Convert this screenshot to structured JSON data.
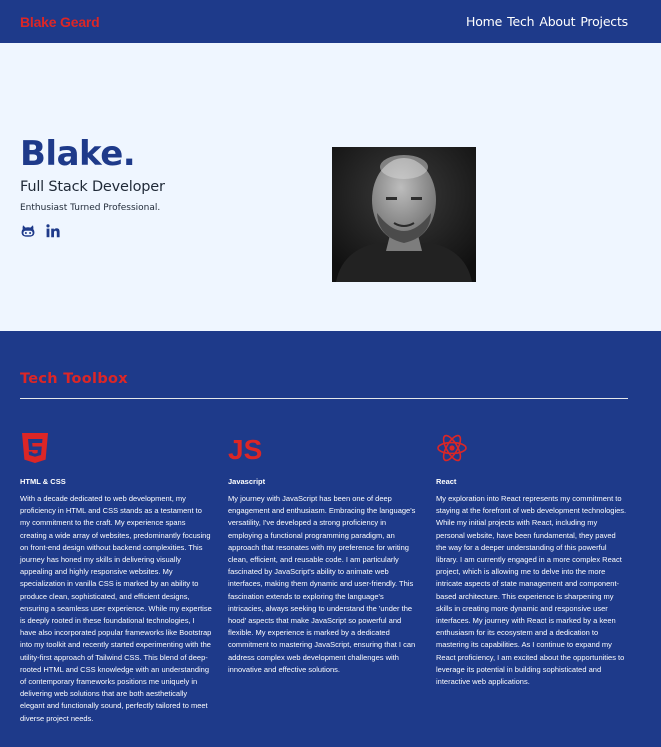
{
  "header": {
    "brand": "Blake Geard",
    "nav": [
      "Home",
      "Tech",
      "About",
      "Projects"
    ]
  },
  "hero": {
    "name": "Blake.",
    "role": "Full Stack Developer",
    "tagline": "Enthusiast Turned Professional.",
    "socials": [
      "github-icon",
      "linkedin-icon"
    ]
  },
  "toolbox": {
    "title": "Tech Toolbox",
    "cards": [
      {
        "icon": "html5-icon",
        "title": "HTML & CSS",
        "text": "With a decade dedicated to web development, my proficiency in HTML and CSS stands as a testament to my commitment to the craft. My experience spans creating a wide array of websites, predominantly focusing on front-end design without backend complexities. This journey has honed my skills in delivering visually appealing and highly responsive websites. My specialization in vanilla CSS is marked by an ability to produce clean, sophisticated, and efficient designs, ensuring a seamless user experience. While my expertise is deeply rooted in these foundational technologies, I have also incorporated popular frameworks like Bootstrap into my toolkit and recently started experimenting with the utility-first approach of Tailwind CSS. This blend of deep-rooted HTML and CSS knowledge with an understanding of contemporary frameworks positions me uniquely in delivering web solutions that are both aesthetically elegant and functionally sound, perfectly tailored to meet diverse project needs."
      },
      {
        "icon": "javascript-icon",
        "title": "Javascript",
        "text": "My journey with JavaScript has been one of deep engagement and enthusiasm. Embracing the language's versatility, I've developed a strong proficiency in employing a functional programming paradigm, an approach that resonates with my preference for writing clean, efficient, and reusable code. I am particularly fascinated by JavaScript's ability to animate web interfaces, making them dynamic and user-friendly. This fascination extends to exploring the language's intricacies, always seeking to understand the 'under the hood' aspects that make JavaScript so powerful and flexible. My experience is marked by a dedicated commitment to mastering JavaScript, ensuring that I can address complex web development challenges with innovative and effective solutions."
      },
      {
        "icon": "react-icon",
        "title": "React",
        "text": "My exploration into React represents my commitment to staying at the forefront of web development technologies. While my initial projects with React, including my personal website, have been fundamental, they paved the way for a deeper understanding of this powerful library. I am currently engaged in a more complex React project, which is allowing me to delve into the more intricate aspects of state management and component-based architecture. This experience is sharpening my skills in creating more dynamic and responsive user interfaces. My journey with React is marked by a keen enthusiasm for its ecosystem and a dedication to mastering its capabilities. As I continue to expand my React proficiency, I am excited about the opportunities to leverage its potential in building sophisticated and interactive web applications."
      }
    ]
  },
  "colors": {
    "navy": "#1e3a8a",
    "accent_red": "#dc2626",
    "hero_bg": "#eff6ff"
  }
}
